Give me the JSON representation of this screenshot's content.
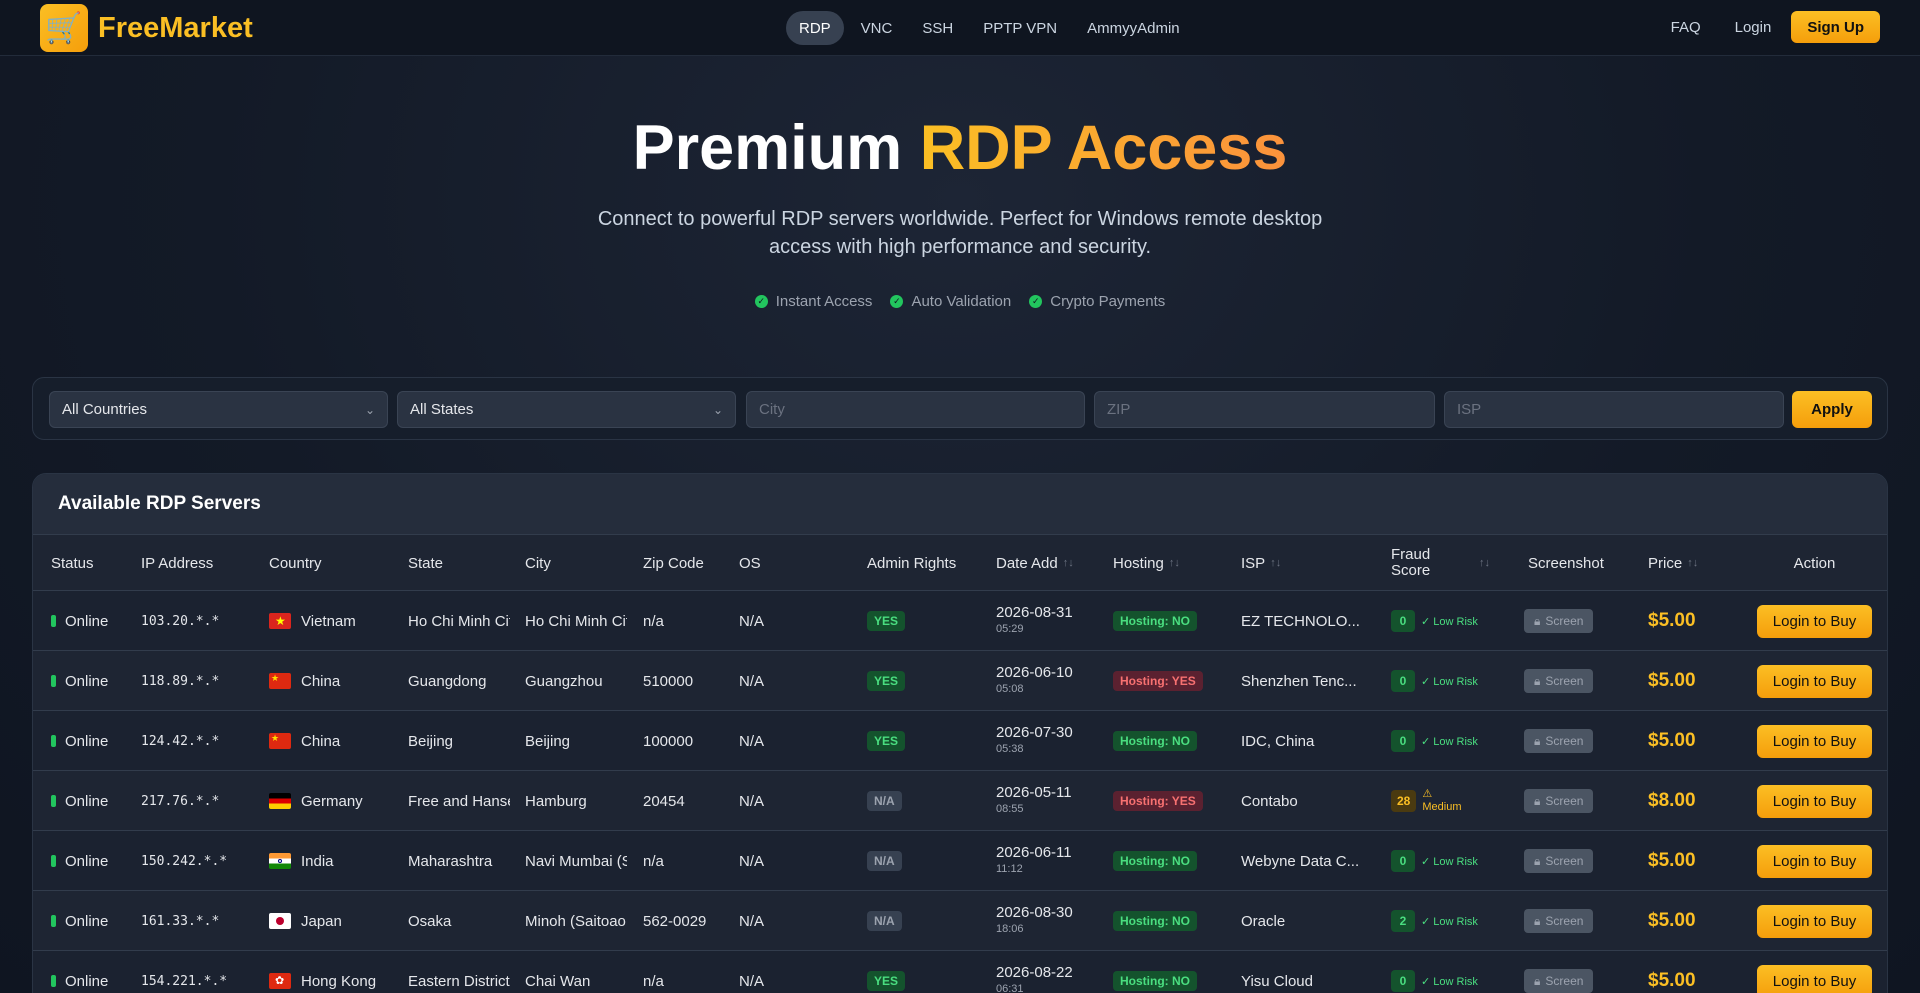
{
  "brand": {
    "name": "FreeMarket",
    "logo_icon": "shopping-cart-icon"
  },
  "nav": {
    "tabs": [
      {
        "label": "RDP",
        "active": true
      },
      {
        "label": "VNC"
      },
      {
        "label": "SSH"
      },
      {
        "label": "PPTP VPN"
      },
      {
        "label": "AmmyyAdmin"
      }
    ],
    "faq": "FAQ",
    "login": "Login",
    "signup": "Sign Up"
  },
  "hero": {
    "title_plain": "Premium",
    "title_accent": "RDP Access",
    "subtitle": "Connect to powerful RDP servers worldwide. Perfect for Windows remote desktop access with high performance and security.",
    "features": [
      "Instant Access",
      "Auto Validation",
      "Crypto Payments"
    ]
  },
  "filters": {
    "country": "All Countries",
    "state": "All States",
    "city_placeholder": "City",
    "zip_placeholder": "ZIP",
    "isp_placeholder": "ISP",
    "apply": "Apply"
  },
  "table": {
    "title": "Available RDP Servers",
    "headers": {
      "status": "Status",
      "ip": "IP Address",
      "country": "Country",
      "state": "State",
      "city": "City",
      "zip": "Zip Code",
      "os": "OS",
      "admin": "Admin Rights",
      "date": "Date Add",
      "hosting": "Hosting",
      "isp": "ISP",
      "fraud": "Fraud Score",
      "screenshot": "Screenshot",
      "price": "Price",
      "action": "Action"
    },
    "rows": [
      {
        "status": "Online",
        "ip": "103.20.*.*",
        "flag": "vn",
        "country": "Vietnam",
        "state": "Ho Chi Minh City",
        "city": "Ho Chi Minh City",
        "zip": "n/a",
        "os": "N/A",
        "admin": "YES",
        "date": "2026-08-31",
        "time": "05:29",
        "hosting": "Hosting: NO",
        "isp": "EZ TECHNOLO...",
        "fraud": "0",
        "risk": "✓ Low Risk",
        "risk_level": "low",
        "screenshot": "Screen",
        "price": "$5.00",
        "action": "Login to Buy"
      },
      {
        "status": "Online",
        "ip": "118.89.*.*",
        "flag": "cn",
        "country": "China",
        "state": "Guangdong",
        "city": "Guangzhou",
        "zip": "510000",
        "os": "N/A",
        "admin": "YES",
        "date": "2026-06-10",
        "time": "05:08",
        "hosting": "Hosting: YES",
        "isp": "Shenzhen Tenc...",
        "fraud": "0",
        "risk": "✓ Low Risk",
        "risk_level": "low",
        "screenshot": "Screen",
        "price": "$5.00",
        "action": "Login to Buy"
      },
      {
        "status": "Online",
        "ip": "124.42.*.*",
        "flag": "cn",
        "country": "China",
        "state": "Beijing",
        "city": "Beijing",
        "zip": "100000",
        "os": "N/A",
        "admin": "YES",
        "date": "2026-07-30",
        "time": "05:38",
        "hosting": "Hosting: NO",
        "isp": "IDC, China",
        "fraud": "0",
        "risk": "✓ Low Risk",
        "risk_level": "low",
        "screenshot": "Screen",
        "price": "$5.00",
        "action": "Login to Buy"
      },
      {
        "status": "Online",
        "ip": "217.76.*.*",
        "flag": "de",
        "country": "Germany",
        "state": "Free and Hanseatic",
        "city": "Hamburg",
        "zip": "20454",
        "os": "N/A",
        "admin": "N/A",
        "date": "2026-05-11",
        "time": "08:55",
        "hosting": "Hosting: YES",
        "isp": "Contabo",
        "fraud": "28",
        "risk": "⚠ Medium",
        "risk_level": "med",
        "screenshot": "Screen",
        "price": "$8.00",
        "action": "Login to Buy"
      },
      {
        "status": "Online",
        "ip": "150.242.*.*",
        "flag": "in",
        "country": "India",
        "state": "Maharashtra",
        "city": "Navi Mumbai (S",
        "zip": "n/a",
        "os": "N/A",
        "admin": "N/A",
        "date": "2026-06-11",
        "time": "11:12",
        "hosting": "Hosting: NO",
        "isp": "Webyne Data C...",
        "fraud": "0",
        "risk": "✓ Low Risk",
        "risk_level": "low",
        "screenshot": "Screen",
        "price": "$5.00",
        "action": "Login to Buy"
      },
      {
        "status": "Online",
        "ip": "161.33.*.*",
        "flag": "jp",
        "country": "Japan",
        "state": "Osaka",
        "city": "Minoh (Saitoao",
        "zip": "562-0029",
        "os": "N/A",
        "admin": "N/A",
        "date": "2026-08-30",
        "time": "18:06",
        "hosting": "Hosting: NO",
        "isp": "Oracle",
        "fraud": "2",
        "risk": "✓ Low Risk",
        "risk_level": "low",
        "screenshot": "Screen",
        "price": "$5.00",
        "action": "Login to Buy"
      },
      {
        "status": "Online",
        "ip": "154.221.*.*",
        "flag": "hk",
        "country": "Hong Kong",
        "state": "Eastern District",
        "city": "Chai Wan",
        "zip": "n/a",
        "os": "N/A",
        "admin": "YES",
        "date": "2026-08-22",
        "time": "06:31",
        "hosting": "Hosting: NO",
        "isp": "Yisu Cloud",
        "fraud": "0",
        "risk": "✓ Low Risk",
        "risk_level": "low",
        "screenshot": "Screen",
        "price": "$5.00",
        "action": "Login to Buy"
      }
    ]
  }
}
